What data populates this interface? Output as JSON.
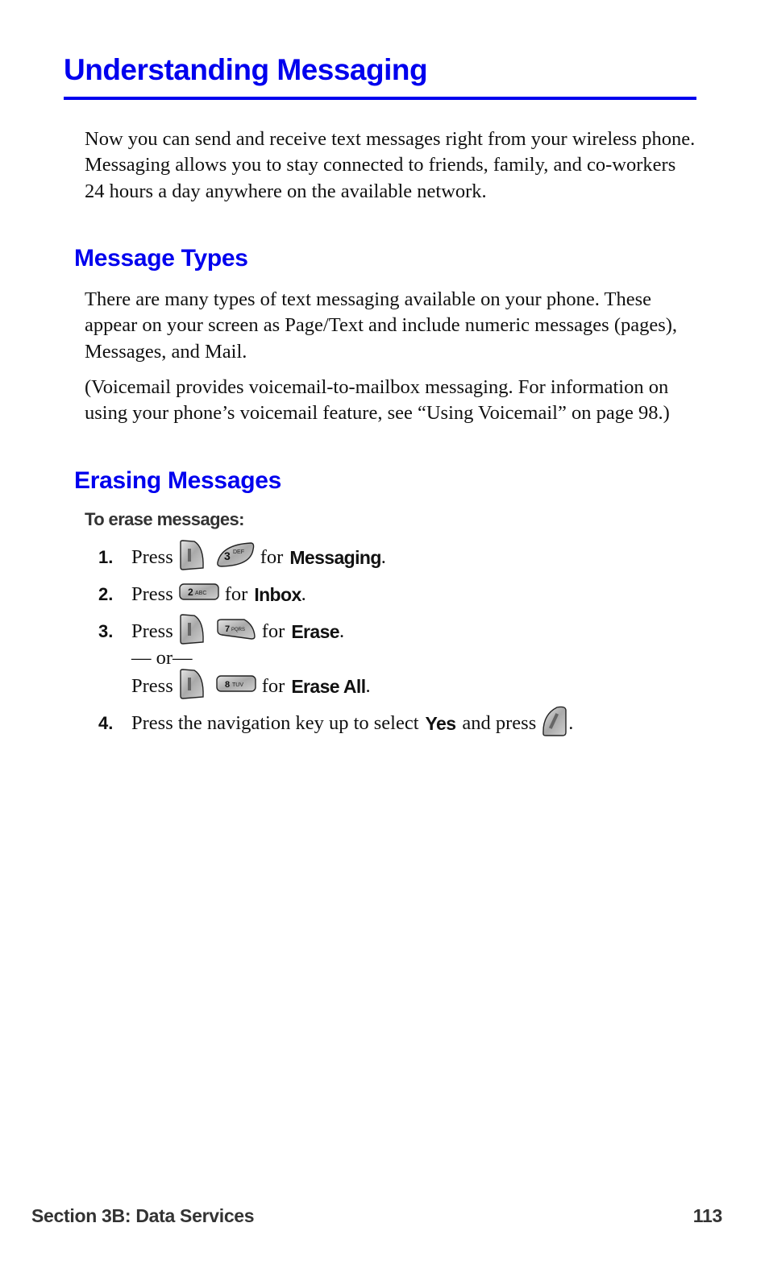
{
  "page": {
    "title": "Understanding Messaging",
    "intro": "Now you can send and receive text messages right from your wireless phone. Messaging allows you to stay connected to friends, family, and co-workers 24 hours a day anywhere on the available network.",
    "sections": [
      {
        "heading": "Message Types",
        "paragraphs": [
          "There are many types of text messaging available on your phone. These appear on your screen as Page/Text and include numeric messages (pages), Messages, and Mail.",
          "(Voicemail provides voicemail-to-mailbox messaging. For information on using your phone’s voicemail feature, see “Using Voicemail” on page 98.)"
        ]
      },
      {
        "heading": "Erasing Messages",
        "lead": "To erase messages:",
        "steps": [
          {
            "number": "1.",
            "press": "Press",
            "keys": [
              "menu-key",
              "3-def-key"
            ],
            "for": "for",
            "target": "Messaging",
            "end": "."
          },
          {
            "number": "2.",
            "press": "Press",
            "keys": [
              "2-abc-key"
            ],
            "for": "for",
            "target": "Inbox",
            "end": "."
          },
          {
            "number": "3.",
            "press": "Press",
            "keys": [
              "menu-key",
              "7-pqrs-key"
            ],
            "for": "for",
            "target": "Erase",
            "end": ".",
            "alt_separator": "— or—",
            "alt": {
              "press": "Press",
              "keys": [
                "menu-key",
                "8-tuv-key"
              ],
              "for": "for",
              "target": "Erase All",
              "end": "."
            }
          },
          {
            "number": "4.",
            "text_before": "Press the navigation key up to select",
            "target": "Yes",
            "text_after": "and press",
            "keys": [
              "ok-key"
            ],
            "end": "."
          }
        ]
      }
    ],
    "key_labels": {
      "menu": "MENU",
      "k3": "3",
      "k3sub": "DEF",
      "k2": "2",
      "k2sub": "ABC",
      "k7": "7",
      "k7sub": "PQRS",
      "k8": "8",
      "k8sub": "TUV",
      "ok": "OK/SEL"
    }
  },
  "footer": {
    "section": "Section 3B: Data Services",
    "page_number": "113"
  },
  "colors": {
    "heading": "#0000ee",
    "footer": "#333333"
  }
}
